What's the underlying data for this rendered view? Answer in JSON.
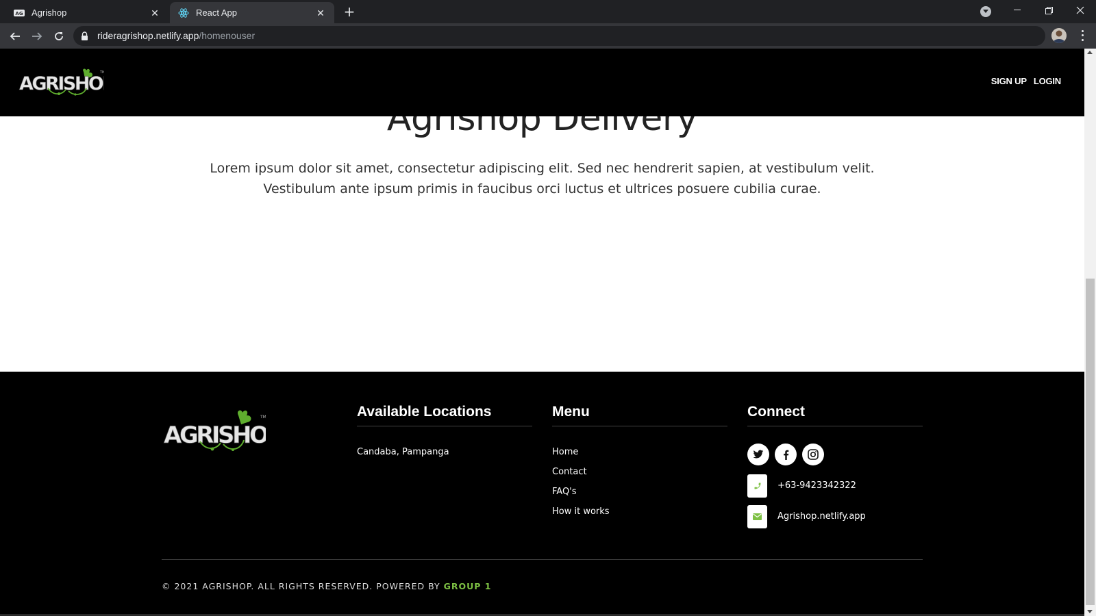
{
  "browser": {
    "tabs": [
      {
        "title": "Agrishop",
        "active": false
      },
      {
        "title": "React App",
        "active": true
      }
    ],
    "url_host": "rideragrishop.netlify.app",
    "url_path": "/homenouser"
  },
  "header": {
    "logo_text": "AGRISHOP",
    "nav": {
      "signup": "SIGN UP",
      "login": "LOGIN"
    }
  },
  "hero": {
    "title": "Agrishop Delivery",
    "line1": "Lorem ipsum dolor sit amet, consectetur adipiscing elit. Sed nec hendrerit sapien, at vestibulum velit.",
    "line2": "Vestibulum ante ipsum primis in faucibus orci luctus et ultrices posuere cubilia curae."
  },
  "footer": {
    "locations": {
      "title": "Available Locations",
      "items": [
        "Candaba, Pampanga"
      ]
    },
    "menu": {
      "title": "Menu",
      "items": [
        "Home",
        "Contact",
        "FAQ's",
        "How it works"
      ]
    },
    "connect": {
      "title": "Connect",
      "social": [
        "twitter-icon",
        "facebook-icon",
        "instagram-icon"
      ],
      "phone": "+63-9423342322",
      "email": "Agrishop.netlify.app"
    },
    "copyright_prefix": "© 2021 AGRISHOP. ALL RIGHTS RESERVED. POWERED BY",
    "copyright_accent": "GROUP 1"
  },
  "colors": {
    "accent": "#7dc043",
    "header_bg": "#000000",
    "page_bg": "#ffffff"
  }
}
